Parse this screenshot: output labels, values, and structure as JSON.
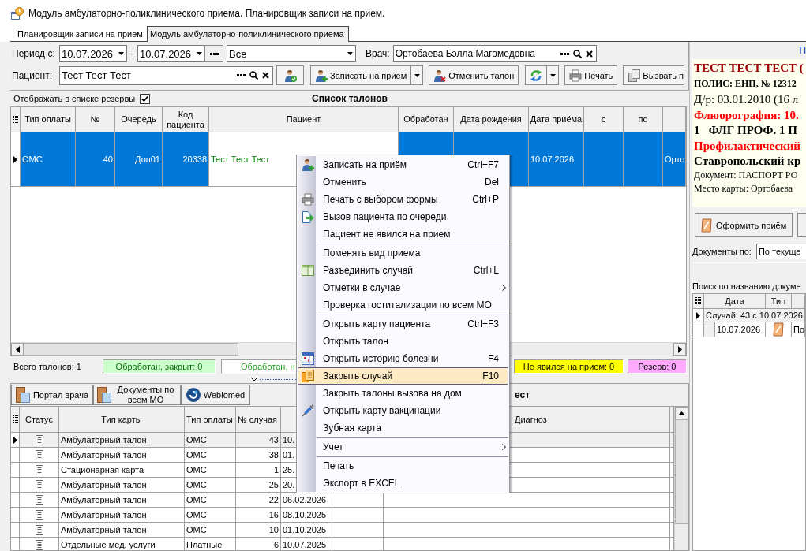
{
  "window": {
    "title": "Модуль амбулаторно-поликлинического приема. Планировщик записи на прием."
  },
  "tabs": [
    {
      "label": "Планировщик записи на прием",
      "selected": false
    },
    {
      "label": "Модуль амбулаторно-поликлинического приема",
      "selected": true
    }
  ],
  "filters": {
    "period_label": "Период с:",
    "date_from": "10.07.2026",
    "dash": "-",
    "date_to": "10.07.2026",
    "scope": "Все",
    "doctor_label": "Врач:",
    "doctor": "Ортобаева Бэлла Магомедовна",
    "patient_label": "Пациент:",
    "patient": "Тест Тест Тест"
  },
  "toolbar": [
    {
      "kind": "icon"
    },
    {
      "kind": "label_split",
      "label": "Записать на приём"
    },
    {
      "kind": "label",
      "label": "Отменить талон"
    },
    {
      "kind": "icon_split"
    },
    {
      "kind": "label",
      "label": "Печать"
    },
    {
      "kind": "label",
      "label": "Вызвать п"
    }
  ],
  "reserves": {
    "label": "Отображать в списке резервы",
    "checked": true
  },
  "tickets": {
    "title": "Список талонов",
    "columns": [
      "Тип оплаты",
      "№",
      "Очередь",
      "Код пациента",
      "Пациент",
      "Обработан",
      "Дата рождения",
      "Дата приёма",
      "с",
      "по"
    ],
    "rows": [
      {
        "selected": true,
        "payment": "ОМС",
        "number": "40",
        "queue": "Доп01",
        "patient_code": "20338",
        "patient": "Тест Тест Тест",
        "visit_date": "10.07.2026",
        "column_11": "Орто"
      }
    ]
  },
  "status": {
    "total": "Всего талонов: 1",
    "counters": [
      {
        "kind": "closed",
        "label": "Обработан, закрыт: 0",
        "color": "#ccffcc"
      },
      {
        "kind": "open",
        "label": "Обработан, н",
        "color": "#ffffff"
      },
      {
        "kind": "no_show",
        "label": "Не явился на прием: 0",
        "color": "#ffff00"
      },
      {
        "kind": "reserve",
        "label": "Резерв: 0",
        "color": "#ffaaff"
      }
    ]
  },
  "cases": {
    "buttons": [
      "Портал врача",
      "Документы по всем МО",
      "Webiomed"
    ],
    "title": "ест",
    "columns": [
      "Статус",
      "Тип карты",
      "Тип оплаты",
      "№ случая",
      "Диагноз"
    ],
    "rows": [
      {
        "selected": true,
        "card_type": "Амбулаторный талон",
        "payment": "ОМС",
        "case_number": "43",
        "date": "10."
      },
      {
        "selected": false,
        "card_type": "Амбулаторный талон",
        "payment": "ОМС",
        "case_number": "38",
        "date": "01."
      },
      {
        "selected": false,
        "card_type": "Стационарная карта",
        "payment": "ОМС",
        "case_number": "1",
        "date": "25."
      },
      {
        "selected": false,
        "card_type": "Амбулаторный талон",
        "payment": "ОМС",
        "case_number": "25",
        "date": "20."
      },
      {
        "selected": false,
        "card_type": "Амбулаторный талон",
        "payment": "ОМС",
        "case_number": "22",
        "date": "06.02.2026"
      },
      {
        "selected": false,
        "card_type": "Амбулаторный талон",
        "payment": "ОМС",
        "case_number": "16",
        "date": "08.10.2025"
      },
      {
        "selected": false,
        "card_type": "Амбулаторный талон",
        "payment": "ОМС",
        "case_number": "10",
        "date": "01.10.2025"
      },
      {
        "selected": false,
        "card_type": "Отдельные мед. услуги",
        "payment": "Платные",
        "case_number": "6",
        "date": "10.07.2025"
      }
    ]
  },
  "patient_card": {
    "heading": "П",
    "lines": [
      {
        "kind": "name",
        "text": "ТЕСТ ТЕСТ ТЕСТ ("
      },
      {
        "kind": "bold",
        "text": "ПОЛИС: ЕНП, № 12312"
      },
      {
        "kind": "plain",
        "text": "Д/р: 03.01.2010 (16 л"
      },
      {
        "kind": "alert",
        "text": "Флюорография: 10."
      },
      {
        "kind": "large",
        "text": "1   ФЛГ ПРОФ. 1 П"
      },
      {
        "kind": "alert",
        "text": "Профилактический"
      },
      {
        "kind": "large",
        "text": "Ставропольский кр"
      },
      {
        "kind": "small",
        "text": "Документ: ПАСПОРТ РО"
      },
      {
        "kind": "small",
        "text": "Место карты: Ортобаева"
      }
    ],
    "action": "Оформить приём",
    "docs_label": "Документы по:",
    "docs_scope": "По текуще",
    "search_label": "Поиск по названию докуме",
    "columns": [
      "Дата",
      "Тип"
    ],
    "groups": [
      {
        "label": "Случай: 43 с 10.07.2026",
        "selected": true,
        "children": [
          {
            "date": "10.07.2026",
            "column_3": "По",
            "selected": false
          }
        ]
      }
    ]
  },
  "context_menu": {
    "groups": [
      {
        "items": [
          {
            "label": "Записать на приём",
            "shortcut": "Ctrl+F7",
            "submenu": false,
            "selected": false
          },
          {
            "label": "Отменить",
            "shortcut": "Del",
            "submenu": false,
            "selected": false
          },
          {
            "label": "Печать с выбором формы",
            "shortcut": "Ctrl+P",
            "submenu": false,
            "selected": false
          },
          {
            "label": "Вызов пациента по очереди",
            "submenu": false,
            "selected": false
          },
          {
            "label": "Пациент не явился на прием",
            "submenu": false,
            "selected": false
          }
        ]
      },
      {
        "items": [
          {
            "label": "Поменять вид приема",
            "submenu": false,
            "selected": false
          },
          {
            "label": "Разъединить случай",
            "shortcut": "Ctrl+L",
            "submenu": false,
            "selected": false
          },
          {
            "label": "Отметки в случае",
            "submenu": true,
            "selected": false
          },
          {
            "label": "Проверка гоститализации по всем МО",
            "submenu": false,
            "selected": false
          }
        ]
      },
      {
        "items": [
          {
            "label": "Открыть карту пациента",
            "shortcut": "Ctrl+F3",
            "submenu": false,
            "selected": false
          },
          {
            "label": "Открыть талон",
            "submenu": false,
            "selected": false
          },
          {
            "label": "Открыть историю болезни",
            "shortcut": "F4",
            "submenu": false,
            "selected": false
          },
          {
            "label": "Закрыть случай",
            "shortcut": "F10",
            "submenu": false,
            "selected": true
          },
          {
            "label": "Закрыть талоны вызова на дом",
            "submenu": false,
            "selected": false
          },
          {
            "label": "Открыть карту вакцинации",
            "submenu": false,
            "selected": false
          },
          {
            "label": "Зубная карта",
            "submenu": false,
            "selected": false
          }
        ]
      },
      {
        "items": [
          {
            "label": "Учет",
            "submenu": true,
            "selected": false
          }
        ]
      },
      {
        "items": [
          {
            "label": "Печать",
            "submenu": false,
            "selected": false
          },
          {
            "label": "Экспорт в EXCEL",
            "submenu": false,
            "selected": false
          }
        ]
      }
    ]
  }
}
